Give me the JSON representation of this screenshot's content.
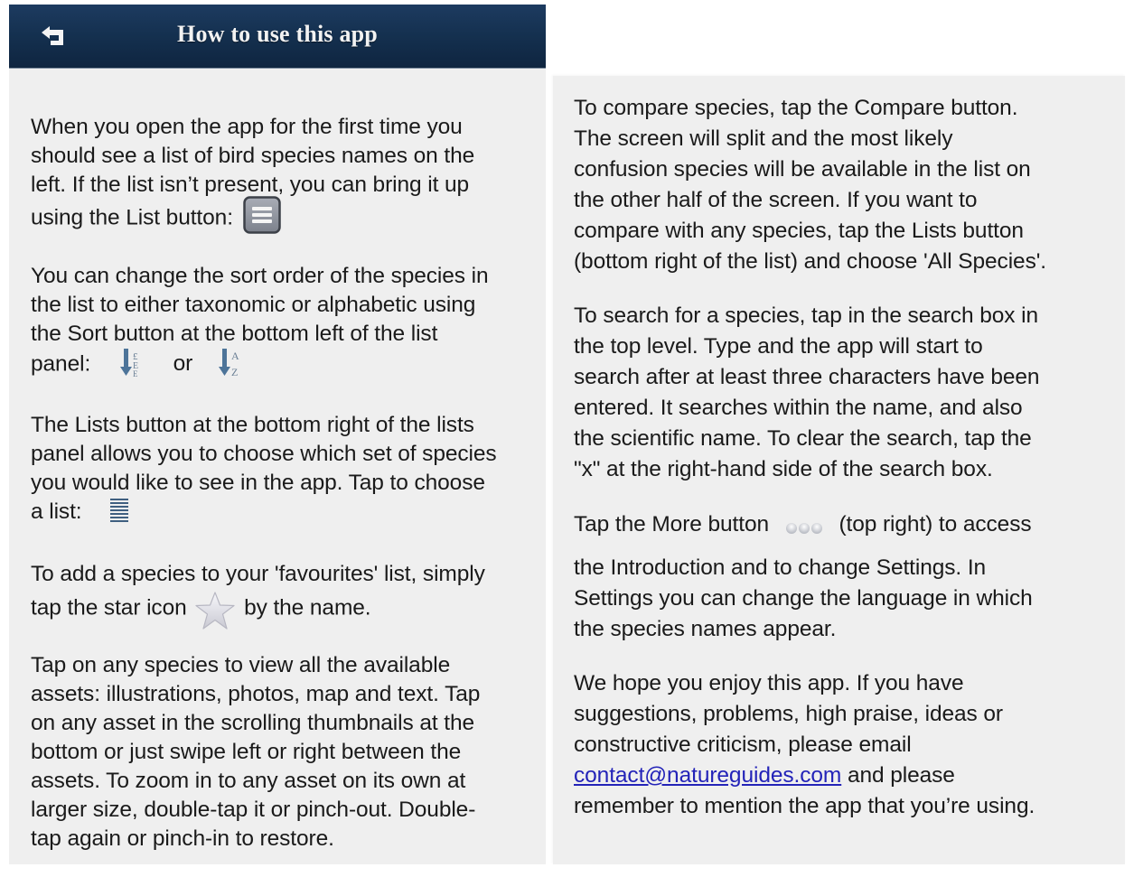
{
  "header": {
    "title": "How to use this app",
    "back_icon": "back-arrow-icon"
  },
  "left": {
    "p1": {
      "lines": [
        "When you open the app for the first time you",
        "should see a list of bird species names on the",
        "left. If the list isn’t present, you can bring it up",
        "using the List button:"
      ],
      "icon": "list-button-icon"
    },
    "p2": {
      "lines": [
        "You can change the sort order of the species in",
        "the list to either taxonomic or alphabetic using",
        "the Sort button at the bottom left of the list",
        "panel:"
      ],
      "or_text": "or",
      "icons": [
        "sort-taxonomic-icon",
        "sort-alphabetic-icon"
      ]
    },
    "p3": {
      "lines": [
        "The Lists button at the bottom right of the lists",
        "panel allows you to choose which set of species",
        "you would like to see in the app. Tap to choose",
        "a list:"
      ],
      "icon": "lists-icon"
    },
    "p4": {
      "lines": [
        "To add a species to your 'favourites' list, simply",
        "tap the star icon",
        "by the name."
      ],
      "icon": "star-icon"
    },
    "p5": {
      "lines": [
        "Tap on any species to view all the available",
        "assets: illustrations, photos, map and text. Tap",
        "on any asset in the scrolling thumbnails at the",
        "bottom or just swipe left or right between the",
        "assets. To zoom in to any asset on its own at",
        "larger size, double-tap it or pinch-out. Double-",
        "tap again or pinch-in to restore."
      ]
    }
  },
  "right": {
    "p1": {
      "lines": [
        "To compare species, tap the Compare button.",
        "The screen will split and the most likely",
        "confusion species will be available in the list on",
        "the other half of the screen. If you want to",
        "compare with any species, tap the Lists button",
        "(bottom right of the list) and choose 'All Species'."
      ]
    },
    "p2": {
      "lines": [
        "To search for a species, tap in the search box in",
        "the top level. Type and the app will start to",
        "search after at least three characters have been",
        "entered. It searches within the name, and also",
        "the scientific name. To clear the search, tap the",
        "\"x\" at the right-hand side of the search box."
      ]
    },
    "p3": {
      "lines": [
        "Tap the More button",
        "(top right) to access",
        "the Introduction and to change Settings. In",
        "Settings you can change the language in which",
        "the species names appear."
      ],
      "icon": "more-dots-icon"
    },
    "p4": {
      "lines": [
        "We hope you enjoy this app. If you have",
        "suggestions, problems, high praise, ideas or",
        "constructive criticism, please email",
        "and please",
        "remember to mention the app that you’re using."
      ],
      "email": "contact@natureguides.com"
    }
  },
  "colors": {
    "navbar": "#14304f",
    "panel_bg": "#efefef",
    "link": "#2323b8",
    "text": "#1a1a1a"
  }
}
